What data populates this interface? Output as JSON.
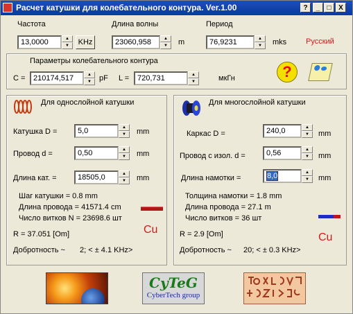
{
  "window": {
    "title": "Расчет катушки для колебательного контура. Ver.1.00",
    "buttons": [
      "?",
      "_",
      "□",
      "X"
    ]
  },
  "top": {
    "frequency_label": "Частота",
    "frequency_value": "13,0000",
    "frequency_unit_btn": "KHz",
    "wavelength_label": "Длина волны",
    "wavelength_value": "23060,958",
    "wavelength_unit": "m",
    "period_label": "Период",
    "period_value": "76,9231",
    "period_unit": "mks",
    "language_link": "Русский"
  },
  "circuit": {
    "title": "Параметры колебательного контура",
    "c_label": "C =",
    "c_value": "210174,517",
    "c_unit": "pF",
    "l_label": "L =",
    "l_value": "720,731",
    "l_unit": "мкГн"
  },
  "single": {
    "title": "Для однослойной катушки",
    "diameter_label": "Катушка D =",
    "diameter_value": "5,0",
    "diameter_unit": "mm",
    "wire_label": "Провод  d =",
    "wire_value": "0,50",
    "wire_unit": "mm",
    "length_label": "Длина кат. =",
    "length_value": "18505,0",
    "length_unit": "mm",
    "pitch": "Шаг  катушки =   0.8 mm",
    "wire_length": "Длина провода = 41571.4 cm",
    "turns": "Число витков N = 23698.6 шт",
    "r": "R =  37.051 [Om]",
    "q_label": "Добротность ~",
    "q_value": "2; < ±   4.1 KHz>",
    "cu": "Cu"
  },
  "multi": {
    "title": "Для многослойной катушки",
    "frame_label": "Каркас   D =",
    "frame_value": "240,0",
    "frame_unit": "mm",
    "wire_label": "Провод с изол. d =",
    "wire_value": "0,56",
    "wire_unit": "mm",
    "winding_label": "Длина намотки   =",
    "winding_value": "8,0",
    "winding_unit": "mm",
    "thickness": "Толщина намотки =    1.8 mm",
    "wire_length": "Длина провода =   27.1 m",
    "turns": "Число витков =    36 шт",
    "r": "R =   2.9 [Om]",
    "q_label": "Добротность ~",
    "q_value": "20; < ±   0.3 KHz>",
    "cu": "Cu"
  },
  "logos": {
    "cyteg": "CyTeG",
    "cyteg_sub": "CyberTech group"
  },
  "colors": {
    "title_bar": "#0b3aa0",
    "accent_red": "#d31a1a",
    "window_bg": "#ece9d8"
  }
}
